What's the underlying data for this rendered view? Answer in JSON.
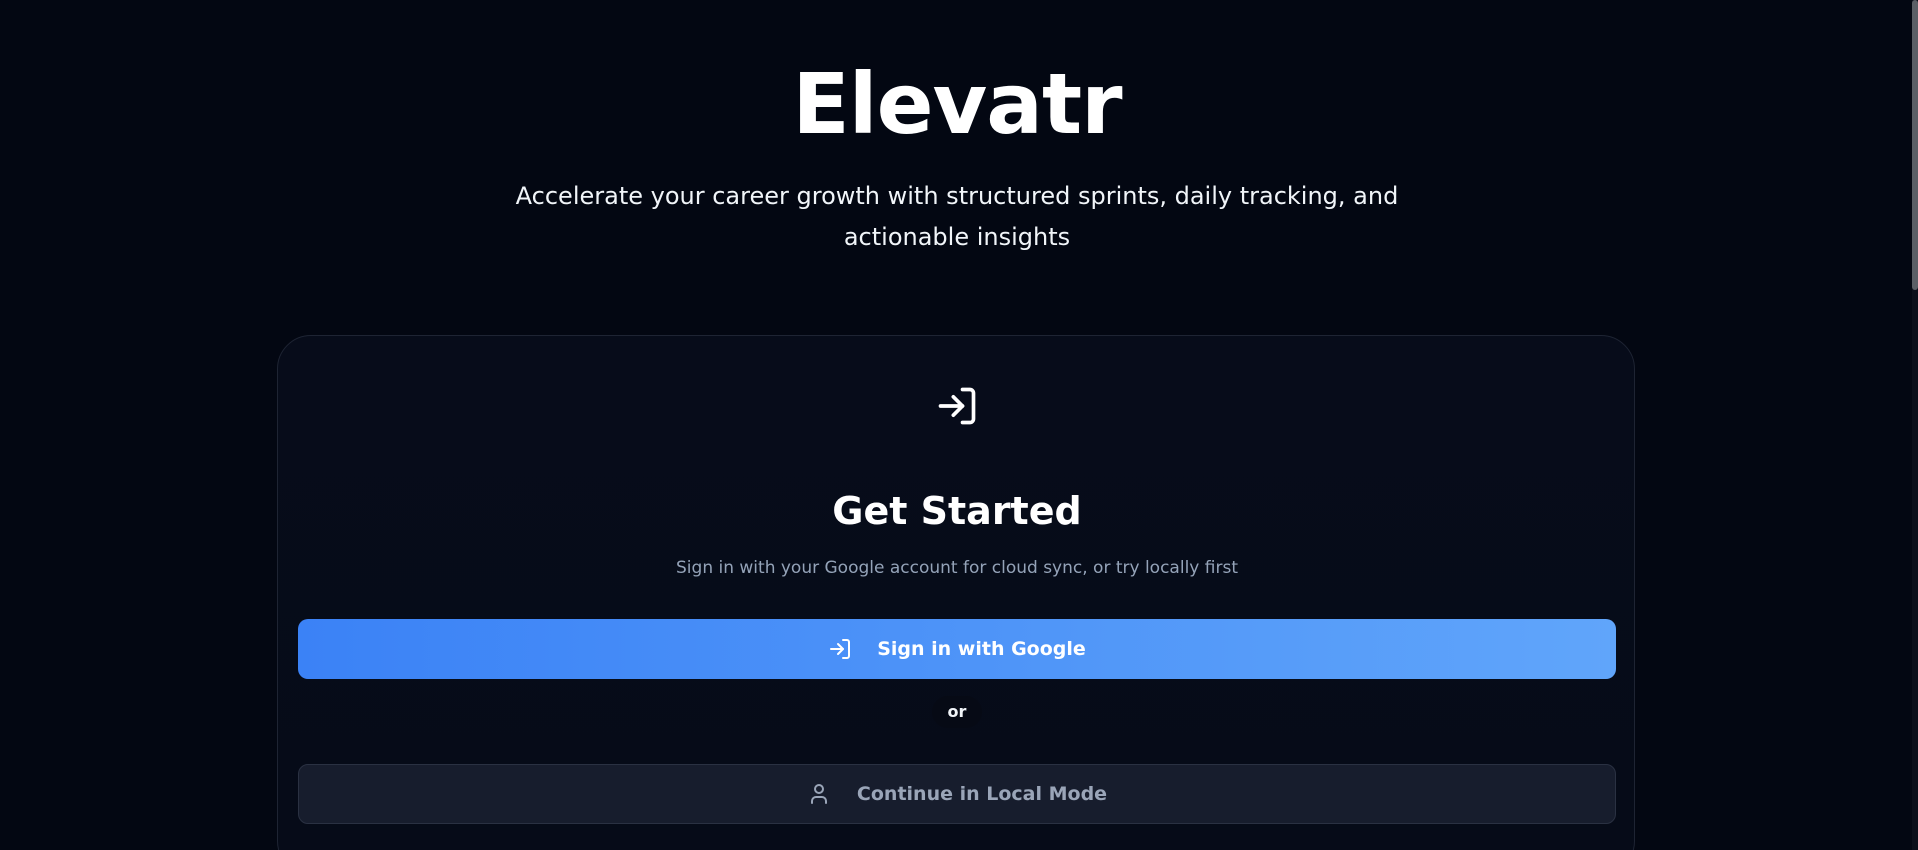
{
  "app": {
    "brand": "Elevatr",
    "tagline": "Accelerate your career growth with structured sprints, daily tracking, and actionable insights"
  },
  "card": {
    "icon": "log-in-icon",
    "title": "Get Started",
    "subtitle": "Sign in with your Google account for cloud sync, or try locally first",
    "google_button": {
      "label": "Sign in with Google",
      "icon": "log-in-icon"
    },
    "divider_label": "or",
    "local_button": {
      "label": "Continue in Local Mode",
      "icon": "user-icon"
    }
  },
  "colors": {
    "background": "#030712",
    "card_background": "#070c1a",
    "primary_gradient_start": "#3b82f6",
    "primary_gradient_end": "#60a5fa",
    "secondary_button": "#171d2d",
    "muted_text": "#94a3b8"
  }
}
